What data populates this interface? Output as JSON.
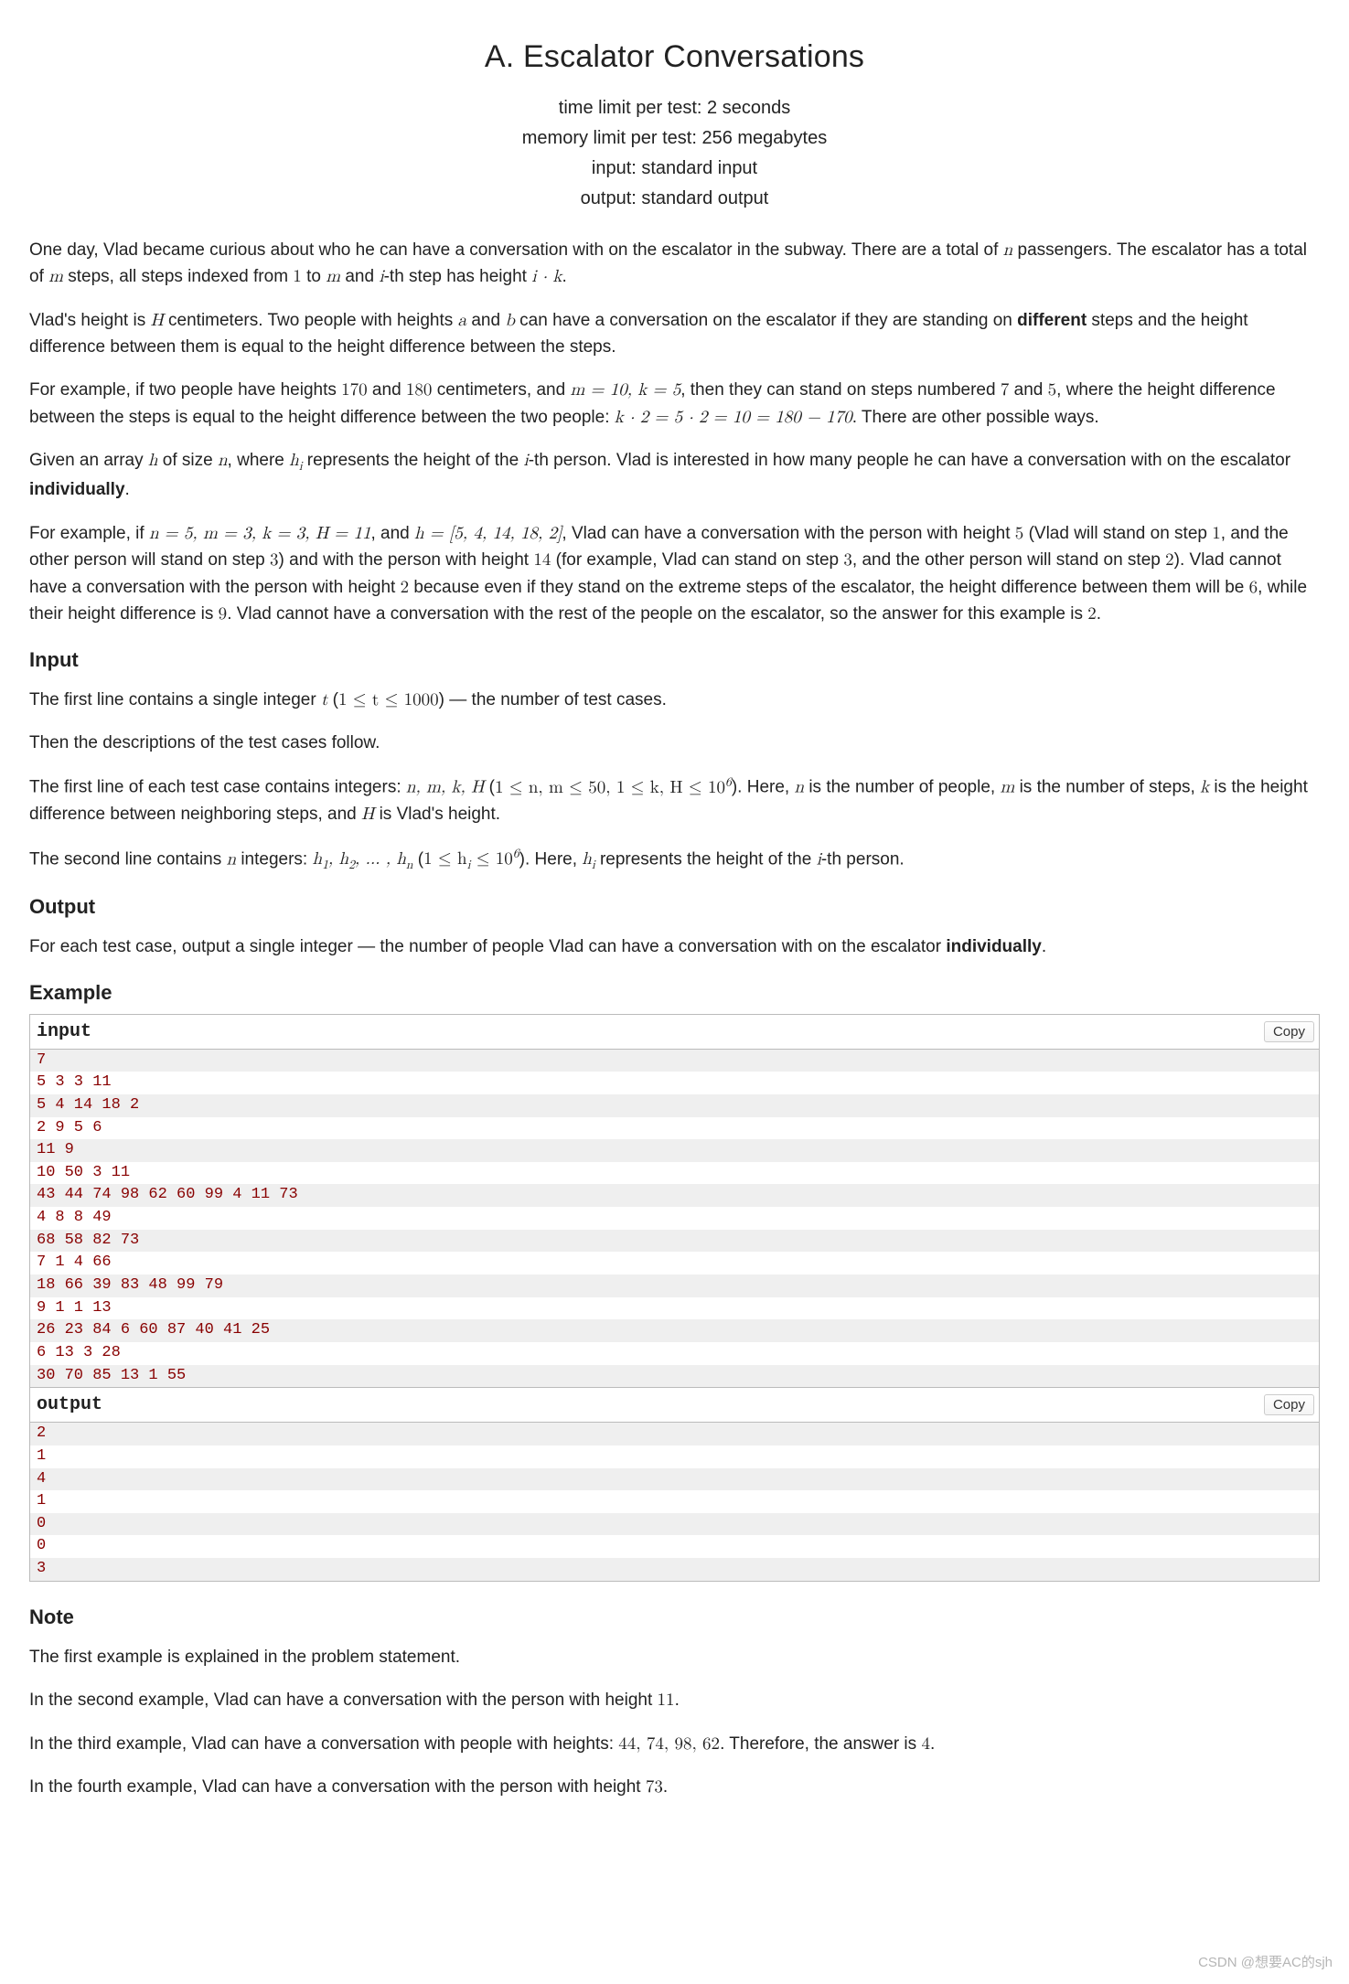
{
  "title": "A. Escalator Conversations",
  "limits": {
    "time": "time limit per test: 2 seconds",
    "memory": "memory limit per test: 256 megabytes",
    "input": "input: standard input",
    "output": "output: standard output"
  },
  "sections": {
    "input_title": "Input",
    "output_title": "Output",
    "example_title": "Example",
    "note_title": "Note"
  },
  "io": {
    "input_label": "input",
    "output_label": "output",
    "copy_label": "Copy",
    "input_lines": [
      "7",
      "5 3 3 11",
      "5 4 14 18 2",
      "2 9 5 6",
      "11 9",
      "10 50 3 11",
      "43 44 74 98 62 60 99 4 11 73",
      "4 8 8 49",
      "68 58 82 73",
      "7 1 4 66",
      "18 66 39 83 48 99 79",
      "9 1 1 13",
      "26 23 84 6 60 87 40 41 25",
      "6 13 3 28",
      "30 70 85 13 1 55"
    ],
    "output_lines": [
      "2",
      "1",
      "4",
      "1",
      "0",
      "0",
      "3"
    ]
  },
  "body": {
    "p1a": "One day, Vlad became curious about who he can have a conversation with on the escalator in the subway. There are a total of ",
    "p1b": " passengers. The escalator has a total of ",
    "p1c": " steps, all steps indexed from ",
    "p1d": " to ",
    "p1e": " and ",
    "p1f": "-th step has height ",
    "p1g": ".",
    "m_n": "n",
    "m_m": "m",
    "m_1": "1",
    "m_i": "i",
    "m_ik": "i · k",
    "p2a": "Vlad's height is ",
    "p2b": " centimeters. Two people with heights ",
    "p2c": " and ",
    "p2d": " can have a conversation on the escalator if they are standing on ",
    "p2diff": "different",
    "p2e": " steps and the height difference between them is equal to the height difference between the steps.",
    "m_H": "H",
    "m_a": "a",
    "m_b": "b",
    "p3a": "For example, if two people have heights ",
    "p3b": " and ",
    "p3c": " centimeters, and ",
    "p3d": ", then they can stand on steps numbered ",
    "p3e": " and ",
    "p3f": ", where the height difference between the steps is equal to the height difference between the two people: ",
    "p3g": ". There are other possible ways.",
    "m_170": "170",
    "m_180": "180",
    "m_mk": "m = 10, k = 5",
    "m_7": "7",
    "m_5": "5",
    "m_eq": "k · 2 = 5 · 2 = 10 = 180 − 170",
    "p4a": "Given an array ",
    "p4b": " of size ",
    "p4c": ", where ",
    "p4d": " represents the height of the ",
    "p4e": "-th person. Vlad is interested in how many people he can have a conversation with on the escalator ",
    "p4ind": "individually",
    "p4f": ".",
    "m_h": "h",
    "m_hi": "h",
    "m_hi_sub": "i",
    "p5a": "For example, if ",
    "p5b": ", and ",
    "p5c": ", Vlad can have a conversation with the person with height ",
    "p5d": " (Vlad will stand on step ",
    "p5e": ", and the other person will stand on step ",
    "p5f": ") and with the person with height ",
    "p5g": " (for example, Vlad can stand on step ",
    "p5h": ", and the other person will stand on step ",
    "p5i": "). Vlad cannot have a conversation with the person with height ",
    "p5j": " because even if they stand on the extreme steps of the escalator, the height difference between them will be ",
    "p5k": ", while their height difference is ",
    "p5l": ". Vlad cannot have a conversation with the rest of the people on the escalator, so the answer for this example is ",
    "p5m": ".",
    "m_ex": "n = 5, m = 3, k = 3, H = 11",
    "m_arr": "h = [5, 4, 14, 18, 2]",
    "m_v5": "5",
    "m_v1": "1",
    "m_v3": "3",
    "m_v14": "14",
    "m_v2": "2",
    "m_v6": "6",
    "m_v9": "9",
    "in_p1a": "The first line contains a single integer ",
    "in_p1b": " (",
    "in_p1c": ") — the number of test cases.",
    "m_t": "t",
    "m_tlim": "1 ≤ t ≤ 1000",
    "in_p2": "Then the descriptions of the test cases follow.",
    "in_p3a": "The first line of each test case contains integers: ",
    "in_p3b": " (",
    "in_p3c": "). Here, ",
    "in_p3d": " is the number of people, ",
    "in_p3e": " is the number of steps, ",
    "in_p3f": " is the height difference between neighboring steps, and ",
    "in_p3g": " is Vlad's height.",
    "m_nmkh": "n, m, k, H",
    "m_lim1": "1 ≤ n, m ≤ 50, 1 ≤ k, H ≤ 10",
    "m_lim1_sup": "6",
    "m_k": "k",
    "in_p4a": "The second line contains ",
    "in_p4b": " integers: ",
    "in_p4c": " (",
    "in_p4d": "). Here, ",
    "in_p4e": " represents the height of the ",
    "in_p4f": "-th person.",
    "m_hlist": "h",
    "m_hlist_1": "1",
    "m_hlist_2": "2",
    "m_hlist_n": "n",
    "m_hlim": "1 ≤ h",
    "m_hlim_sub": "i",
    "m_hlim2": " ≤ 10",
    "m_hlim_sup": "6",
    "out_p1a": "For each test case, output a single integer — the number of people Vlad can have a conversation with on the escalator ",
    "out_p1b": ".",
    "note_p1": "The first example is explained in the problem statement.",
    "note_p2a": "In the second example, Vlad can have a conversation with the person with height ",
    "note_p2b": ".",
    "m_n11": "11",
    "note_p3a": "In the third example, Vlad can have a conversation with people with heights: ",
    "note_p3b": ". Therefore, the answer is ",
    "note_p3c": ".",
    "m_list3": "44, 74, 98, 62",
    "m_ans4": "4",
    "note_p4a": "In the fourth example, Vlad can have a conversation with the person with height ",
    "note_p4b": ".",
    "m_n73": "73"
  },
  "watermark": "CSDN @想要AC的sjh"
}
